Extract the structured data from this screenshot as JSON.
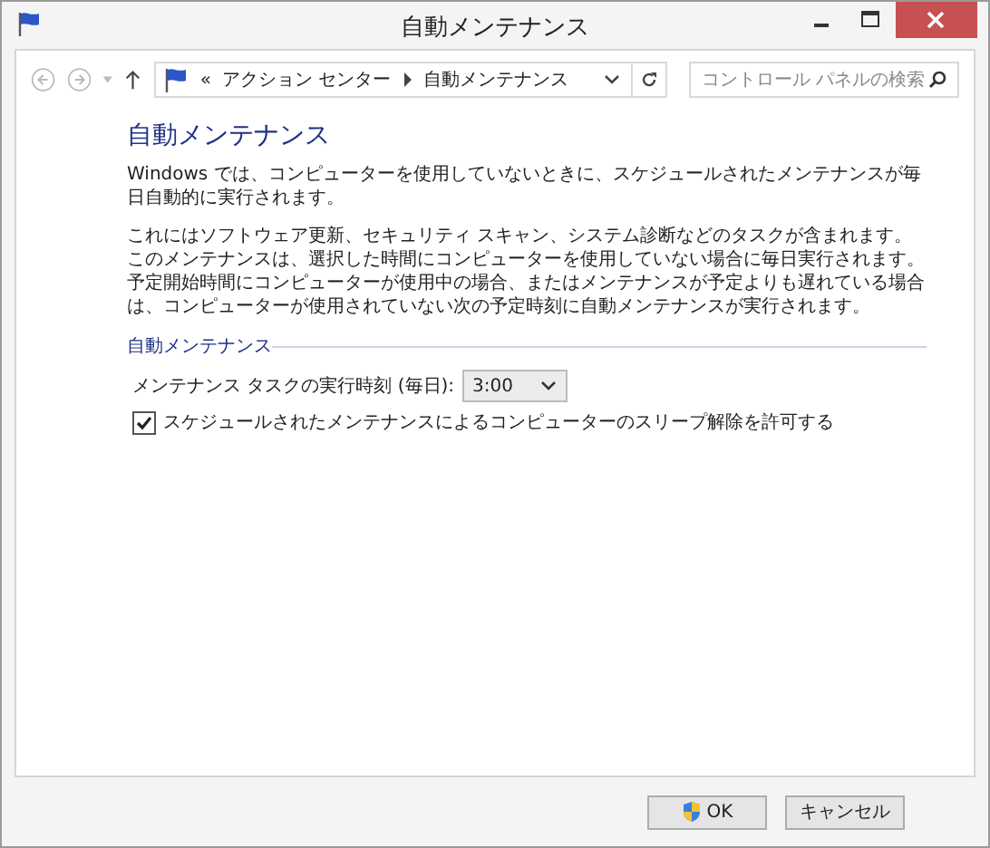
{
  "window": {
    "title": "自動メンテナンス"
  },
  "nav": {
    "breadcrumb_prefix": "«",
    "breadcrumb": [
      "アクション センター",
      "自動メンテナンス"
    ],
    "search": {
      "placeholder": "コントロール パネルの検索"
    }
  },
  "heading": "自動メンテナンス",
  "paragraphs": [
    "Windows では、コンピューターを使用していないときに、スケジュールされたメンテナンスが毎日自動的に実行されます。",
    "これにはソフトウェア更新、セキュリティ スキャン、システム診断などのタスクが含まれます。このメンテナンスは、選択した時間にコンピューターを使用していない場合に毎日実行されます。予定開始時間にコンピューターが使用中の場合、またはメンテナンスが予定よりも遅れている場合は、コンピューターが使用されていない次の予定時刻に自動メンテナンスが実行されます。"
  ],
  "section": {
    "title": "自動メンテナンス",
    "time_label": "メンテナンス タスクの実行時刻 (毎日):",
    "time_value": "3:00",
    "wake": {
      "label": "スケジュールされたメンテナンスによるコンピューターのスリープ解除を許可する",
      "checked": true
    }
  },
  "buttons": [
    {
      "label": "OK",
      "shield": true
    },
    {
      "label": "キャンセル",
      "shield": false
    }
  ]
}
